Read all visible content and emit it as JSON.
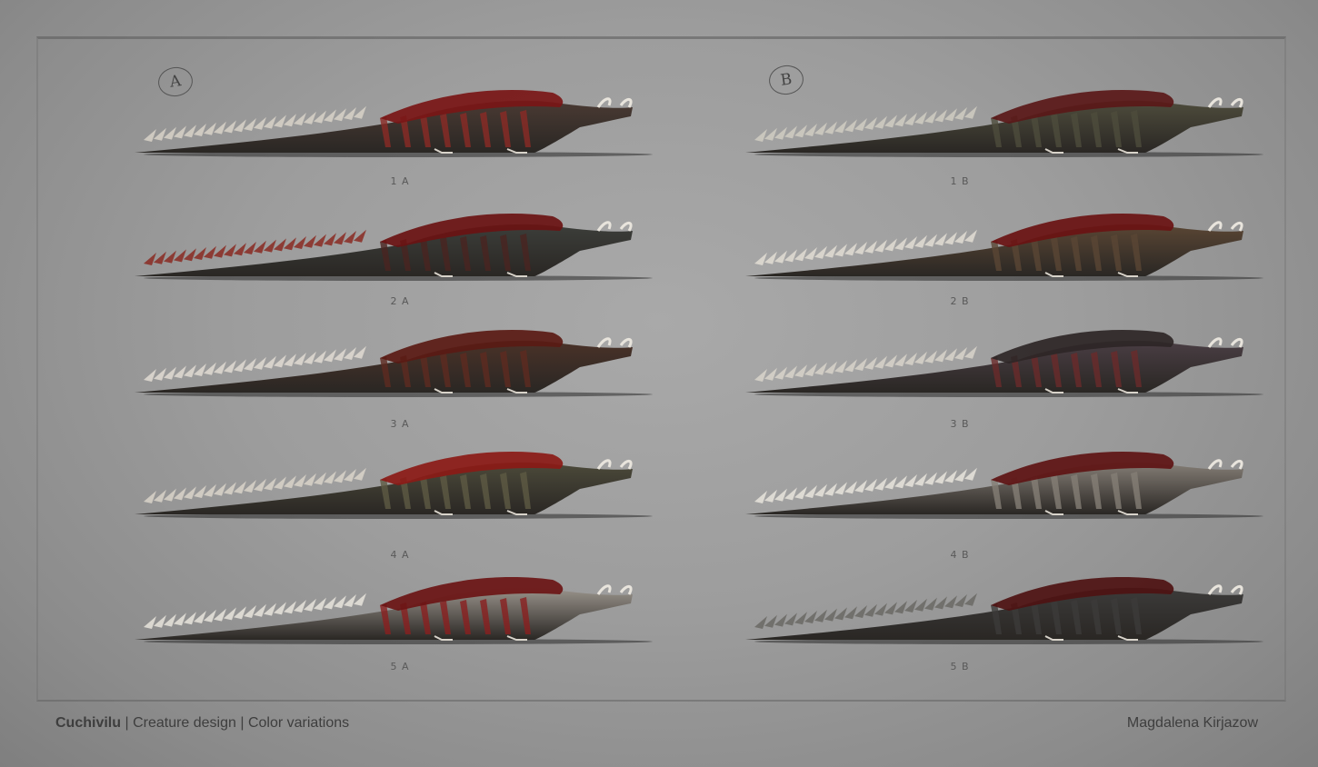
{
  "columns": [
    {
      "marker": "A",
      "variants": [
        {
          "label": "1 A",
          "body": "#4a3a33",
          "mane": "#7a1616",
          "stripe": "#8b2a25",
          "spikes": "#d8d2c8"
        },
        {
          "label": "2 A",
          "body": "#3c3e3a",
          "mane": "#6a1212",
          "stripe": "#4a2421",
          "spikes": "#8a2a22"
        },
        {
          "label": "3 A",
          "body": "#4a3228",
          "mane": "#5a1a14",
          "stripe": "#5e2b20",
          "spikes": "#e0dbd2"
        },
        {
          "label": "4 A",
          "body": "#4c4a3a",
          "mane": "#8b1a16",
          "stripe": "#5e5a44",
          "spikes": "#d9d4c9"
        },
        {
          "label": "5 A",
          "body": "#9a948c",
          "mane": "#6b1515",
          "stripe": "#8a1f1f",
          "spikes": "#e8e4dc"
        }
      ]
    },
    {
      "marker": "B",
      "variants": [
        {
          "label": "1 B",
          "body": "#4e4c3c",
          "mane": "#5a1818",
          "stripe": "#4e4c3c",
          "spikes": "#d0ccc2"
        },
        {
          "label": "2 B",
          "body": "#5a4634",
          "mane": "#6a1212",
          "stripe": "#5a4634",
          "spikes": "#e2ddd3"
        },
        {
          "label": "3 B",
          "body": "#4a3e44",
          "mane": "#2e2626",
          "stripe": "#6a2a2a",
          "spikes": "#d8d3ca"
        },
        {
          "label": "4 B",
          "body": "#857e76",
          "mane": "#5e1414",
          "stripe": "#857e76",
          "spikes": "#e8e4dc"
        },
        {
          "label": "5 B",
          "body": "#3c3b3a",
          "mane": "#4e1212",
          "stripe": "#3c3b3a",
          "spikes": "#6a6864"
        }
      ]
    }
  ],
  "footer": {
    "title": "Cuchivilu",
    "subtitle": " | Creature design | Color variations",
    "author": "Magdalena Kirjazow"
  }
}
